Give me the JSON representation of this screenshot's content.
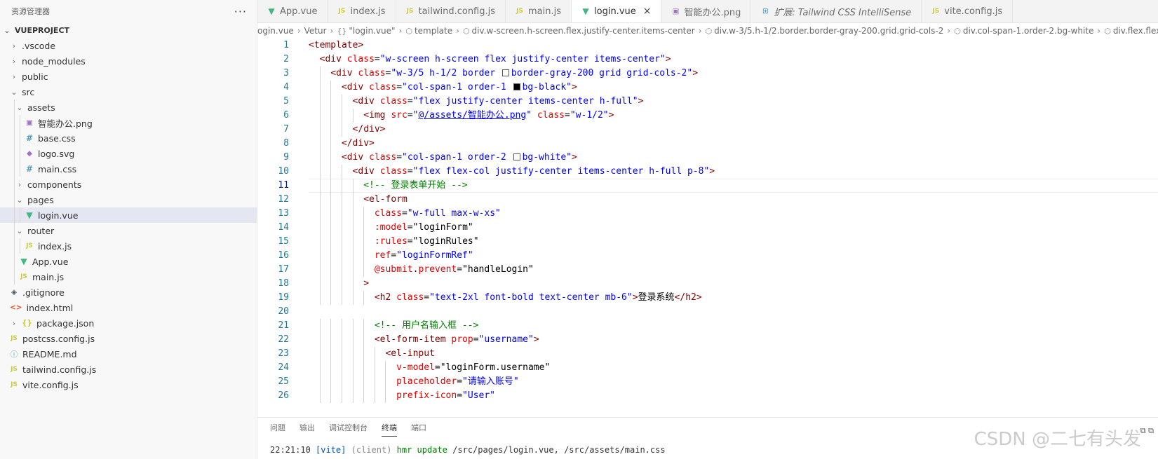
{
  "explorer": {
    "title": "资源管理器",
    "more": "···",
    "root": "VUEPROJECT",
    "items": [
      {
        "label": ".vscode",
        "type": "folder",
        "expanded": false,
        "depth": 0,
        "icon": ""
      },
      {
        "label": "node_modules",
        "type": "folder",
        "expanded": false,
        "depth": 0,
        "icon": ""
      },
      {
        "label": "public",
        "type": "folder",
        "expanded": false,
        "depth": 0,
        "icon": ""
      },
      {
        "label": "src",
        "type": "folder",
        "expanded": true,
        "depth": 0,
        "icon": ""
      },
      {
        "label": "assets",
        "type": "folder",
        "expanded": true,
        "depth": 1,
        "icon": ""
      },
      {
        "label": "智能办公.png",
        "type": "file",
        "depth": 2,
        "icon": "image-icon",
        "glyph": "▣"
      },
      {
        "label": "base.css",
        "type": "file",
        "depth": 2,
        "icon": "css-icon",
        "glyph": "#"
      },
      {
        "label": "logo.svg",
        "type": "file",
        "depth": 2,
        "icon": "svg-icon",
        "glyph": "◆"
      },
      {
        "label": "main.css",
        "type": "file",
        "depth": 2,
        "icon": "css-icon",
        "glyph": "#"
      },
      {
        "label": "components",
        "type": "folder",
        "expanded": false,
        "depth": 1,
        "icon": ""
      },
      {
        "label": "pages",
        "type": "folder",
        "expanded": true,
        "depth": 1,
        "icon": ""
      },
      {
        "label": "login.vue",
        "type": "file",
        "depth": 2,
        "icon": "vue-icon",
        "glyph": "▼",
        "selected": true
      },
      {
        "label": "router",
        "type": "folder",
        "expanded": true,
        "depth": 1,
        "icon": ""
      },
      {
        "label": "index.js",
        "type": "file",
        "depth": 2,
        "icon": "js-icon",
        "glyph": "JS"
      },
      {
        "label": "App.vue",
        "type": "file",
        "depth": 1,
        "icon": "vue-icon",
        "glyph": "▼"
      },
      {
        "label": "main.js",
        "type": "file",
        "depth": 1,
        "icon": "js-icon",
        "glyph": "JS"
      },
      {
        "label": ".gitignore",
        "type": "file",
        "depth": 0,
        "icon": "git-icon",
        "glyph": "◈"
      },
      {
        "label": "index.html",
        "type": "file",
        "depth": 0,
        "icon": "html-icon",
        "glyph": "<>"
      },
      {
        "label": "package.json",
        "type": "folder-json",
        "expanded": false,
        "depth": 0,
        "icon": "json-icon",
        "glyph": "{}"
      },
      {
        "label": "postcss.config.js",
        "type": "file",
        "depth": 0,
        "icon": "js-icon",
        "glyph": "JS"
      },
      {
        "label": "README.md",
        "type": "file",
        "depth": 0,
        "icon": "info-icon",
        "glyph": "ⓘ"
      },
      {
        "label": "tailwind.config.js",
        "type": "file",
        "depth": 0,
        "icon": "js-icon",
        "glyph": "JS"
      },
      {
        "label": "vite.config.js",
        "type": "file",
        "depth": 0,
        "icon": "js-icon",
        "glyph": "JS"
      }
    ]
  },
  "tabs": [
    {
      "label": "App.vue",
      "icon": "vue-icon",
      "glyph": "▼",
      "active": false
    },
    {
      "label": "index.js",
      "icon": "js-icon",
      "glyph": "JS",
      "active": false
    },
    {
      "label": "tailwind.config.js",
      "icon": "js-icon",
      "glyph": "JS",
      "active": false
    },
    {
      "label": "main.js",
      "icon": "js-icon",
      "glyph": "JS",
      "active": false
    },
    {
      "label": "login.vue",
      "icon": "vue-icon",
      "glyph": "▼",
      "active": true,
      "close": "×"
    },
    {
      "label": "智能办公.png",
      "icon": "image-icon",
      "glyph": "▣",
      "active": false
    },
    {
      "label": "扩展: Tailwind CSS IntelliSense",
      "icon": "extension-icon",
      "glyph": "⊞",
      "active": false,
      "italic": true
    },
    {
      "label": "vite.config.js",
      "icon": "js-icon",
      "glyph": "JS",
      "active": false
    }
  ],
  "breadcrumb": [
    {
      "label": "ogin.vue",
      "icon": ""
    },
    {
      "label": "Vetur",
      "icon": ""
    },
    {
      "label": "\"login.vue\"",
      "icon": "{}"
    },
    {
      "label": "template",
      "icon": "⬡"
    },
    {
      "label": "div.w-screen.h-screen.flex.justify-center.items-center",
      "icon": "⬡"
    },
    {
      "label": "div.w-3/5.h-1/2.border.border-gray-200.grid.grid-cols-2",
      "icon": "⬡"
    },
    {
      "label": "div.col-span-1.order-2.bg-white",
      "icon": "⬡"
    },
    {
      "label": "div.flex.flex-co",
      "icon": "⬡"
    }
  ],
  "editor": {
    "current_line": 11,
    "lines": [
      {
        "n": "1",
        "indent": 0,
        "tokens": [
          [
            "tg",
            "<template>"
          ]
        ]
      },
      {
        "n": "2",
        "indent": 1,
        "tokens": [
          [
            "tg",
            "<div "
          ],
          [
            "at",
            "class"
          ],
          [
            "pl",
            "="
          ],
          [
            "av",
            "\"w-screen h-screen flex justify-center items-center\""
          ],
          [
            "tg",
            ">"
          ]
        ]
      },
      {
        "n": "3",
        "indent": 2,
        "tokens": [
          [
            "tg",
            "<div "
          ],
          [
            "at",
            "class"
          ],
          [
            "pl",
            "="
          ],
          [
            "av",
            "\"w-3/5 h-1/2 border "
          ],
          [
            "sw",
            "#ffffff"
          ],
          [
            "av",
            "border-gray-200 grid grid-cols-2\""
          ],
          [
            "tg",
            ">"
          ]
        ]
      },
      {
        "n": "4",
        "indent": 3,
        "tokens": [
          [
            "tg",
            "<div "
          ],
          [
            "at",
            "class"
          ],
          [
            "pl",
            "="
          ],
          [
            "av",
            "\"col-span-1 order-1 "
          ],
          [
            "sw",
            "#000000"
          ],
          [
            "av",
            "bg-black\""
          ],
          [
            "tg",
            ">"
          ]
        ]
      },
      {
        "n": "5",
        "indent": 4,
        "tokens": [
          [
            "tg",
            "<div "
          ],
          [
            "at",
            "class"
          ],
          [
            "pl",
            "="
          ],
          [
            "av",
            "\"flex justify-center items-center h-full\""
          ],
          [
            "tg",
            ">"
          ]
        ]
      },
      {
        "n": "6",
        "indent": 5,
        "tokens": [
          [
            "tg",
            "<img "
          ],
          [
            "at",
            "src"
          ],
          [
            "pl",
            "="
          ],
          [
            "av",
            "\""
          ],
          [
            "avu",
            "@/assets/智能办公.png"
          ],
          [
            "av",
            "\""
          ],
          [
            "pl",
            " "
          ],
          [
            "at",
            "class"
          ],
          [
            "pl",
            "="
          ],
          [
            "av",
            "\"w-1/2\""
          ],
          [
            "tg",
            ">"
          ]
        ]
      },
      {
        "n": "7",
        "indent": 4,
        "tokens": [
          [
            "tg",
            "</div>"
          ]
        ]
      },
      {
        "n": "8",
        "indent": 3,
        "tokens": [
          [
            "tg",
            "</div>"
          ]
        ]
      },
      {
        "n": "9",
        "indent": 3,
        "tokens": [
          [
            "tg",
            "<div "
          ],
          [
            "at",
            "class"
          ],
          [
            "pl",
            "="
          ],
          [
            "av",
            "\"col-span-1 order-2 "
          ],
          [
            "sw",
            "#ffffff"
          ],
          [
            "av",
            "bg-white\""
          ],
          [
            "tg",
            ">"
          ]
        ]
      },
      {
        "n": "10",
        "indent": 4,
        "tokens": [
          [
            "tg",
            "<div "
          ],
          [
            "at",
            "class"
          ],
          [
            "pl",
            "="
          ],
          [
            "av",
            "\"flex flex-col justify-center items-center h-full p-8\""
          ],
          [
            "tg",
            ">"
          ]
        ]
      },
      {
        "n": "11",
        "indent": 5,
        "tokens": [
          [
            "cm",
            "<!-- 登录表单开始 -->"
          ]
        ]
      },
      {
        "n": "12",
        "indent": 5,
        "tokens": [
          [
            "tg",
            "<el-form"
          ]
        ]
      },
      {
        "n": "13",
        "indent": 6,
        "tokens": [
          [
            "at",
            "class"
          ],
          [
            "pl",
            "="
          ],
          [
            "av",
            "\"w-full max-w-xs\""
          ]
        ]
      },
      {
        "n": "14",
        "indent": 6,
        "tokens": [
          [
            "at",
            ":model"
          ],
          [
            "pl",
            "=\"loginForm\""
          ]
        ]
      },
      {
        "n": "15",
        "indent": 6,
        "tokens": [
          [
            "at",
            ":rules"
          ],
          [
            "pl",
            "=\"loginRules\""
          ]
        ]
      },
      {
        "n": "16",
        "indent": 6,
        "tokens": [
          [
            "at",
            "ref"
          ],
          [
            "pl",
            "="
          ],
          [
            "av",
            "\"loginFormRef\""
          ]
        ]
      },
      {
        "n": "17",
        "indent": 6,
        "tokens": [
          [
            "at",
            "@submit"
          ],
          [
            "pl",
            "."
          ],
          [
            "at",
            "prevent"
          ],
          [
            "pl",
            "=\"handleLogin\""
          ]
        ]
      },
      {
        "n": "18",
        "indent": 5,
        "tokens": [
          [
            "tg",
            ">"
          ]
        ]
      },
      {
        "n": "19",
        "indent": 6,
        "tokens": [
          [
            "tg",
            "<h2 "
          ],
          [
            "at",
            "class"
          ],
          [
            "pl",
            "="
          ],
          [
            "av",
            "\"text-2xl font-bold text-center mb-6\""
          ],
          [
            "tg",
            ">"
          ],
          [
            "pl",
            "登录系统"
          ],
          [
            "tg",
            "</h2>"
          ]
        ]
      },
      {
        "n": "20",
        "indent": 0,
        "tokens": []
      },
      {
        "n": "21",
        "indent": 6,
        "tokens": [
          [
            "cm",
            "<!-- 用户名输入框 -->"
          ]
        ]
      },
      {
        "n": "22",
        "indent": 6,
        "tokens": [
          [
            "tg",
            "<el-form-item "
          ],
          [
            "at",
            "prop"
          ],
          [
            "pl",
            "="
          ],
          [
            "av",
            "\"username\""
          ],
          [
            "tg",
            ">"
          ]
        ]
      },
      {
        "n": "23",
        "indent": 7,
        "tokens": [
          [
            "tg",
            "<el-input"
          ]
        ]
      },
      {
        "n": "24",
        "indent": 8,
        "tokens": [
          [
            "at",
            "v-model"
          ],
          [
            "pl",
            "=\"loginForm.username\""
          ]
        ]
      },
      {
        "n": "25",
        "indent": 8,
        "tokens": [
          [
            "at",
            "placeholder"
          ],
          [
            "pl",
            "="
          ],
          [
            "av",
            "\"请输入账号\""
          ]
        ]
      },
      {
        "n": "26",
        "indent": 8,
        "tokens": [
          [
            "at",
            "prefix-icon"
          ],
          [
            "pl",
            "="
          ],
          [
            "av",
            "\"User\""
          ]
        ]
      }
    ]
  },
  "panel": {
    "tabs": [
      "问题",
      "输出",
      "调试控制台",
      "终端",
      "端口"
    ],
    "active_tab": "终端",
    "terminal": {
      "time": "22:21:10",
      "tag": "[vite]",
      "client": "(client)",
      "msg": "hmr update",
      "paths": "/src/pages/login.vue, /src/assets/main.css"
    },
    "icons": "⧉ ⧉"
  },
  "watermark": "CSDN @二七有头发"
}
